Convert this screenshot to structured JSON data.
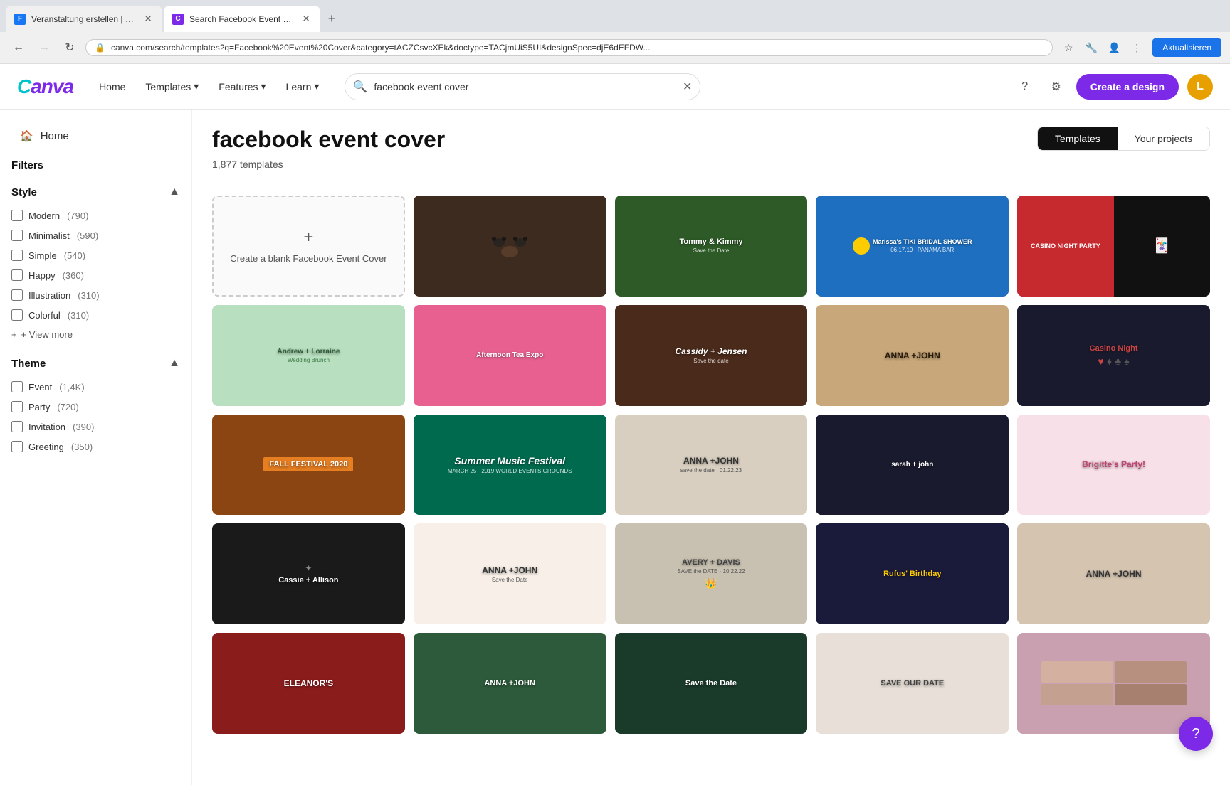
{
  "browser": {
    "tabs": [
      {
        "id": "tab1",
        "favicon_color": "#1877f2",
        "favicon_letter": "F",
        "title": "Veranstaltung erstellen | Faceb...",
        "active": false
      },
      {
        "id": "tab2",
        "favicon_color": "#7d2ae8",
        "favicon_letter": "C",
        "title": "Search Facebook Event Cover",
        "active": true
      }
    ],
    "new_tab_label": "+",
    "back_disabled": false,
    "forward_disabled": true,
    "reload_label": "↻",
    "url": "canva.com/search/templates?q=Facebook%20Event%20Cover&category=tACZCsvcXEk&doctype=TACjmUiS5UI&designSpec=djE6dEFDW...",
    "bookmark_icon": "★",
    "extension_icons": [
      "🔧",
      "⊞",
      "⬜",
      "👤"
    ],
    "update_btn_label": "Aktualisieren"
  },
  "header": {
    "logo": "Canva",
    "nav_items": [
      {
        "label": "Home",
        "has_dropdown": false
      },
      {
        "label": "Templates",
        "has_dropdown": true
      },
      {
        "label": "Features",
        "has_dropdown": true
      },
      {
        "label": "Learn",
        "has_dropdown": true
      }
    ],
    "search_placeholder": "facebook event cover",
    "search_value": "facebook event cover",
    "create_design_label": "Create a design",
    "user_initial": "L"
  },
  "sidebar": {
    "home_label": "Home",
    "filters_title": "Filters",
    "style_section": {
      "title": "Style",
      "items": [
        {
          "label": "Modern",
          "count": "(790)"
        },
        {
          "label": "Minimalist",
          "count": "(590)"
        },
        {
          "label": "Simple",
          "count": "(540)"
        },
        {
          "label": "Happy",
          "count": "(360)"
        },
        {
          "label": "Illustration",
          "count": "(310)"
        },
        {
          "label": "Colorful",
          "count": "(310)"
        }
      ],
      "view_more_label": "+ View more"
    },
    "theme_section": {
      "title": "Theme",
      "items": [
        {
          "label": "Event",
          "count": "(1,4K)"
        },
        {
          "label": "Party",
          "count": "(720)"
        },
        {
          "label": "Invitation",
          "count": "(390)"
        },
        {
          "label": "Greeting",
          "count": "(350)"
        }
      ]
    }
  },
  "content": {
    "title": "facebook event cover",
    "template_count": "1,877 templates",
    "tabs": [
      {
        "label": "Templates",
        "active": true
      },
      {
        "label": "Your projects",
        "active": false
      }
    ],
    "blank_card": {
      "plus_icon": "+",
      "label": "Create a blank Facebook Event Cover"
    },
    "templates": [
      {
        "id": "t1",
        "color_class": "card-paws",
        "text": "",
        "subtitle": ""
      },
      {
        "id": "t2",
        "color_class": "card-tommy",
        "text": "Tommy & Kimmy",
        "subtitle": "Save the Date"
      },
      {
        "id": "t3",
        "color_class": "card-marissa",
        "text": "Marissa's TIKI BRIDAL SHOWER",
        "subtitle": "06.17.19 | PANAMA BAR"
      },
      {
        "id": "t4",
        "color_class": "card-casino1",
        "text": "CASINO NIGHT PARTY",
        "subtitle": ""
      },
      {
        "id": "t5",
        "color_class": "tc5",
        "text": "Andrew + Lorraine",
        "subtitle": "Wedding Brunch"
      },
      {
        "id": "t6",
        "color_class": "tc6",
        "text": "Afternoon Tea Expo",
        "subtitle": ""
      },
      {
        "id": "t7",
        "color_class": "tc7",
        "text": "Cassidy + Jensen",
        "subtitle": "Save the date"
      },
      {
        "id": "t8",
        "color_class": "tc8",
        "text": "ANNA +JOHN",
        "subtitle": ""
      },
      {
        "id": "t9",
        "color_class": "tc9",
        "text": "Casino Night",
        "subtitle": ""
      },
      {
        "id": "t10",
        "color_class": "tc10",
        "text": "FALL FESTIVAL 2020",
        "subtitle": ""
      },
      {
        "id": "t11",
        "color_class": "tc11",
        "text": "Summer Music Festival",
        "subtitle": "MARCH 25 - 2019 WORLD EVENTS GROUNDS"
      },
      {
        "id": "t12",
        "color_class": "tc12",
        "text": "ANNA +JOHN",
        "subtitle": "save the date · 01.22.23"
      },
      {
        "id": "t13",
        "color_class": "tc13",
        "text": "sarah + john",
        "subtitle": ""
      },
      {
        "id": "t14",
        "color_class": "tc14",
        "text": "Brigitte's Party!",
        "subtitle": ""
      },
      {
        "id": "t15",
        "color_class": "tc15",
        "text": "Cassie + Allison",
        "subtitle": ""
      },
      {
        "id": "t16",
        "color_class": "tc16",
        "text": "ANNA +JOHN",
        "subtitle": "Save the Date"
      },
      {
        "id": "t17",
        "color_class": "tc17",
        "text": "AVERY + DAVIS",
        "subtitle": "SAVE the DATE · 10.22.22"
      },
      {
        "id": "t18",
        "color_class": "tc18",
        "text": "Rufus' Birthday",
        "subtitle": ""
      },
      {
        "id": "t19",
        "color_class": "tc19",
        "text": "ANNA +JOHN",
        "subtitle": ""
      },
      {
        "id": "t20",
        "color_class": "tc20",
        "text": "ELEANOR'S",
        "subtitle": ""
      }
    ]
  },
  "floating_help": "?"
}
